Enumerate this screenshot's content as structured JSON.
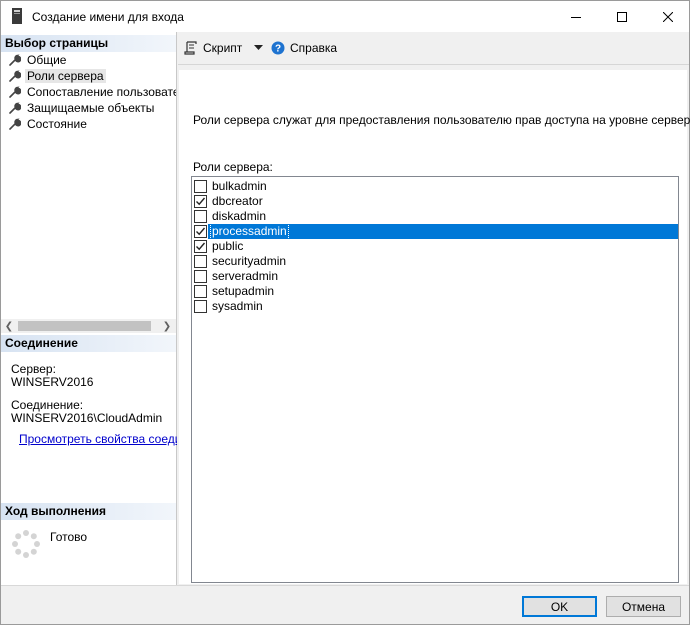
{
  "window": {
    "title": "Создание имени для входа"
  },
  "left": {
    "pages_header": "Выбор страницы",
    "pages": [
      {
        "label": "Общие",
        "selected": false
      },
      {
        "label": "Роли сервера",
        "selected": true
      },
      {
        "label": "Сопоставление пользователей",
        "selected": false
      },
      {
        "label": "Защищаемые объекты",
        "selected": false
      },
      {
        "label": "Состояние",
        "selected": false
      }
    ],
    "connection_header": "Соединение",
    "server_label": "Сервер:",
    "server_value": "WINSERV2016",
    "connection_label": "Соединение:",
    "connection_value": "WINSERV2016\\CloudAdmin",
    "view_link": "Просмотреть свойства соединения",
    "progress_header": "Ход выполнения",
    "progress_status": "Готово"
  },
  "toolbar": {
    "script_label": "Скрипт",
    "help_label": "Справка"
  },
  "main": {
    "description": "Роли сервера служат для предоставления пользователю прав доступа на уровне сервера.",
    "roles_label": "Роли сервера:",
    "roles": [
      {
        "name": "bulkadmin",
        "checked": false,
        "selected": false
      },
      {
        "name": "dbcreator",
        "checked": true,
        "selected": false
      },
      {
        "name": "diskadmin",
        "checked": false,
        "selected": false
      },
      {
        "name": "processadmin",
        "checked": true,
        "selected": true
      },
      {
        "name": "public",
        "checked": true,
        "selected": false
      },
      {
        "name": "securityadmin",
        "checked": false,
        "selected": false
      },
      {
        "name": "serveradmin",
        "checked": false,
        "selected": false
      },
      {
        "name": "setupadmin",
        "checked": false,
        "selected": false
      },
      {
        "name": "sysadmin",
        "checked": false,
        "selected": false
      }
    ]
  },
  "buttons": {
    "ok": "OK",
    "cancel": "Отмена"
  },
  "colors": {
    "selection": "#0078d7",
    "link": "#0000cc",
    "header_gradient_start": "#d7e3f2"
  }
}
